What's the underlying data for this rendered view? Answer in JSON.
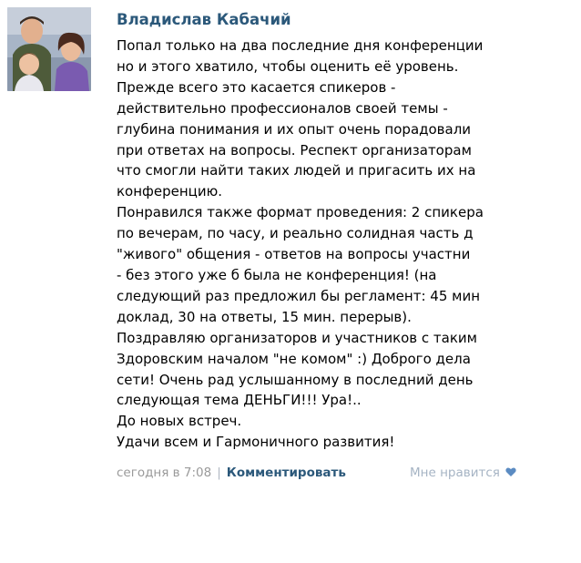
{
  "post": {
    "author": "Владислав Кабачий",
    "avatar_icon": "family-photo-avatar",
    "lines": [
      "Попал только на два последние дня конференции",
      "но и этого хватило, чтобы оценить её уровень.",
      "Прежде всего это касается спикеров -",
      "действительно профессионалов своей темы -",
      "глубина понимания и их опыт очень порадовали",
      "при ответах на вопросы. Респект организаторам",
      "что смогли найти таких людей и пригасить их на",
      "конференцию.",
      "Понравился также формат проведения: 2 спикера",
      "по вечерам, по часу, и реально солидная часть д",
      "\"живого\" общения - ответов на вопросы участни",
      "- без этого уже б была не конференция! (на",
      "следующий раз предложил бы регламент: 45 мин",
      "доклад, 30 на ответы, 15 мин. перерыв).",
      "Поздравляю организаторов и участников с таким",
      "Здоровским началом \"не комом\" :) Доброго дела",
      "сети! Очень рад услышанному в последний день",
      "следующая тема ДЕНЬГИ!!! Ура!..",
      "До новых встреч.",
      "Удачи всем и Гармоничного развития!"
    ],
    "meta": {
      "date": "сегодня в 7:08",
      "separator": "|",
      "comment_label": "Комментировать",
      "like_label": "Мне нравится",
      "like_icon": "heart-icon"
    }
  },
  "colors": {
    "author": "#2b587a",
    "text": "#000000",
    "meta": "#9a9a9a",
    "link": "#2b587a",
    "like": "#a6b4c4"
  }
}
